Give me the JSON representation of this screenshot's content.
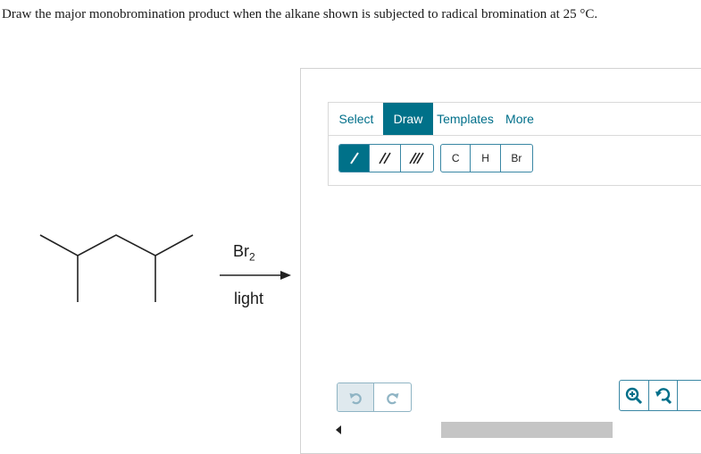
{
  "question": {
    "text": "Draw the major monobromination product when the alkane shown is subjected to radical bromination at 25 °C."
  },
  "reaction": {
    "reagent_symbol": "Br",
    "reagent_subscript": "2",
    "condition": "light"
  },
  "editor": {
    "menu": {
      "select": "Select",
      "draw": "Draw",
      "templates": "Templates",
      "more": "More",
      "active": "Draw"
    },
    "bond_tools": [
      {
        "name": "single-bond-icon",
        "selected": true
      },
      {
        "name": "double-bond-icon",
        "selected": false
      },
      {
        "name": "triple-bond-icon",
        "selected": false
      }
    ],
    "atom_tools": {
      "carbon": "C",
      "hydrogen": "H",
      "bromine": "Br"
    },
    "icons": {
      "undo": "undo-icon",
      "redo": "redo-icon",
      "zoom_in": "zoom-in-icon",
      "zoom_reset": "zoom-reset-icon",
      "scroll_left": "scroll-left-arrow-icon"
    }
  },
  "colors": {
    "accent": "#007189",
    "accent_text": "#006f8a",
    "scroll_thumb": "#c5c5c5"
  }
}
